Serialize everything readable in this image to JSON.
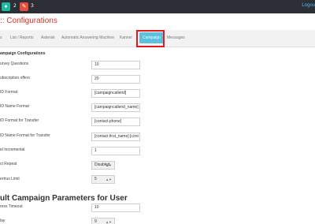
{
  "topbar": {
    "badge_chat": "2",
    "badge_edit": "3",
    "logout": "Logou"
  },
  "header": {
    "title": ":: Configurations"
  },
  "tabs": [
    {
      "label": "s"
    },
    {
      "label": "List / Reports"
    },
    {
      "label": "Asterisk"
    },
    {
      "label": "Automatic Answering Machine"
    },
    {
      "label": "Kannel"
    },
    {
      "label": "Campaign",
      "active": true
    },
    {
      "label": "Messages"
    }
  ],
  "campaign": {
    "section_title": "ampaign Configurations",
    "fields": [
      {
        "label": "urvey Questions",
        "value": "10"
      },
      {
        "label": "ubscription offers",
        "value": "20"
      },
      {
        "label": "ID Format",
        "value": "[campaigncallerid]"
      },
      {
        "label": "ID Name Format",
        "value": "[campaigncallerid_name]"
      },
      {
        "label": "ID Format for Transfer",
        "value": "[contact.phone]"
      },
      {
        "label": "ID Name Format for Transfer",
        "value": "[contact.first_name] [cont"
      },
      {
        "label": "el Incremental",
        "value": "1"
      }
    ],
    "selects": [
      {
        "label": "ct Repeat",
        "value": "Disabled"
      },
      {
        "label": "ertrus Limit",
        "value": "5"
      }
    ]
  },
  "default_section": {
    "title": "ult Campaign Parameters for User",
    "fields": [
      {
        "label": "ress Timeout",
        "value": "10"
      }
    ],
    "selects": [
      {
        "label": "lay",
        "value": "9"
      }
    ]
  }
}
